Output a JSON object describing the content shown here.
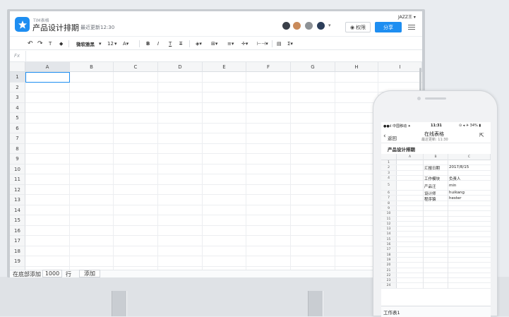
{
  "desktop": {
    "app_name": "TIM表格",
    "doc_title": "产品设计排期",
    "last_updated": "最近更新12:30",
    "user_badge": "JAZZ王 ▾",
    "avatar_more": "▾",
    "permission_label": "权限",
    "share_label": "分享",
    "toolbar": {
      "font_name": "微软雅黑",
      "font_size": "12"
    },
    "formula_label": "Fx",
    "columns": [
      "A",
      "B",
      "C",
      "D",
      "E",
      "F",
      "G",
      "H",
      "I"
    ],
    "rows": [
      "1",
      "2",
      "3",
      "4",
      "5",
      "6",
      "7",
      "8",
      "9",
      "10",
      "11",
      "12",
      "13",
      "14",
      "15",
      "16",
      "17",
      "18",
      "19",
      "20"
    ],
    "footer": {
      "prefix": "在底部添加",
      "count": "1000",
      "unit": "行",
      "add_label": "添加"
    }
  },
  "mobile": {
    "status_left": "●●ıl 中国移动 ✦",
    "status_time": "11:31",
    "status_right": "⊙ ◂ ✈ 34% ▮",
    "back_label": "返回",
    "title": "在线表格",
    "subtitle": "最近更新: 11:30",
    "sheet_title": "产品设计排期",
    "columns": [
      "A",
      "B",
      "C"
    ],
    "rows": [
      "1",
      "2",
      "3",
      "4",
      "5",
      "6",
      "7",
      "8",
      "9",
      "10",
      "11",
      "12",
      "13",
      "14",
      "15",
      "16",
      "17",
      "18",
      "19",
      "20",
      "21",
      "22",
      "23",
      "24"
    ],
    "cells": [
      {
        "row": "2",
        "b": "汇报日期",
        "c": "2017/8/15"
      },
      {
        "row": "4",
        "b": "工作模块",
        "c": "负责人"
      },
      {
        "row": "5",
        "b": "产品汪",
        "c": "min"
      },
      {
        "row": "6",
        "b": "设计师",
        "c": "huikang"
      },
      {
        "row": "7",
        "b": "程序猿",
        "c": "hester"
      }
    ],
    "sheet_tab": "工作表1"
  },
  "colors": {
    "accent": "#1e8ef1"
  }
}
